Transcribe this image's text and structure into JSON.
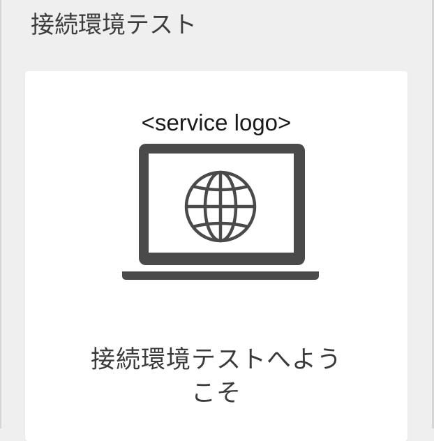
{
  "header": {
    "title": "接続環境テスト"
  },
  "card": {
    "logo_placeholder": "<service logo>",
    "illustration_icon": "laptop-globe-icon",
    "welcome_line1": "接続環境テストへよう",
    "welcome_line2": "こそ"
  },
  "colors": {
    "background": "#efefef",
    "card": "#ffffff",
    "icon": "#4a4a4a",
    "text": "#3a3a3a"
  }
}
